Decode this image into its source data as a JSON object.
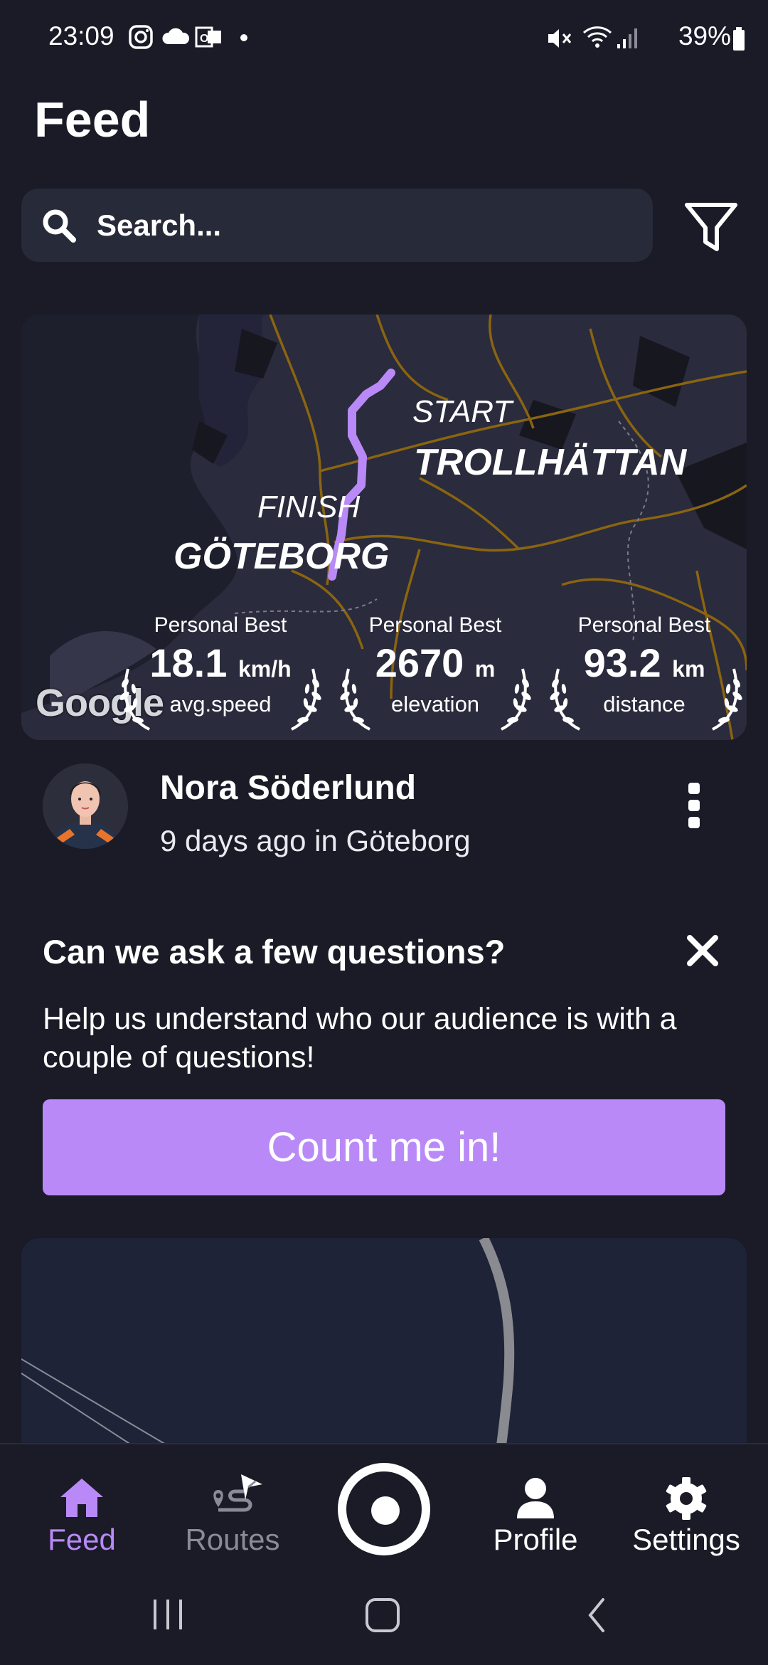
{
  "status_bar": {
    "time": "23:09",
    "battery": "39%"
  },
  "header": {
    "title": "Feed"
  },
  "search": {
    "placeholder": "Search..."
  },
  "map_card": {
    "start_label": "START",
    "start_city": "TROLLHÄTTAN",
    "finish_label": "FINISH",
    "finish_city": "GÖTEBORG",
    "map_attribution": "Google",
    "route_color": "#b98af7",
    "stats": [
      {
        "heading": "Personal Best",
        "value": "18.1",
        "unit": "km/h",
        "label": "avg.speed"
      },
      {
        "heading": "Personal Best",
        "value": "2670",
        "unit": "m",
        "label": "elevation"
      },
      {
        "heading": "Personal Best",
        "value": "93.2",
        "unit": "km",
        "label": "distance"
      }
    ]
  },
  "post": {
    "author": "Nora Söderlund",
    "meta": "9 days ago in Göteborg"
  },
  "survey": {
    "title": "Can we ask a few questions?",
    "body": "Help us understand who our audience is with a couple of questions!",
    "button": "Count me in!",
    "accent": "#b98af7"
  },
  "bottom_nav": {
    "items": [
      {
        "label": "Feed",
        "icon": "home-icon",
        "active": true
      },
      {
        "label": "Routes",
        "icon": "routes-icon",
        "active": false
      },
      {
        "label": "Profile",
        "icon": "person-icon",
        "active": false
      },
      {
        "label": "Settings",
        "icon": "gear-icon",
        "active": false
      }
    ],
    "active_color": "#b98af7",
    "inactive_color": "#8a8b96"
  }
}
